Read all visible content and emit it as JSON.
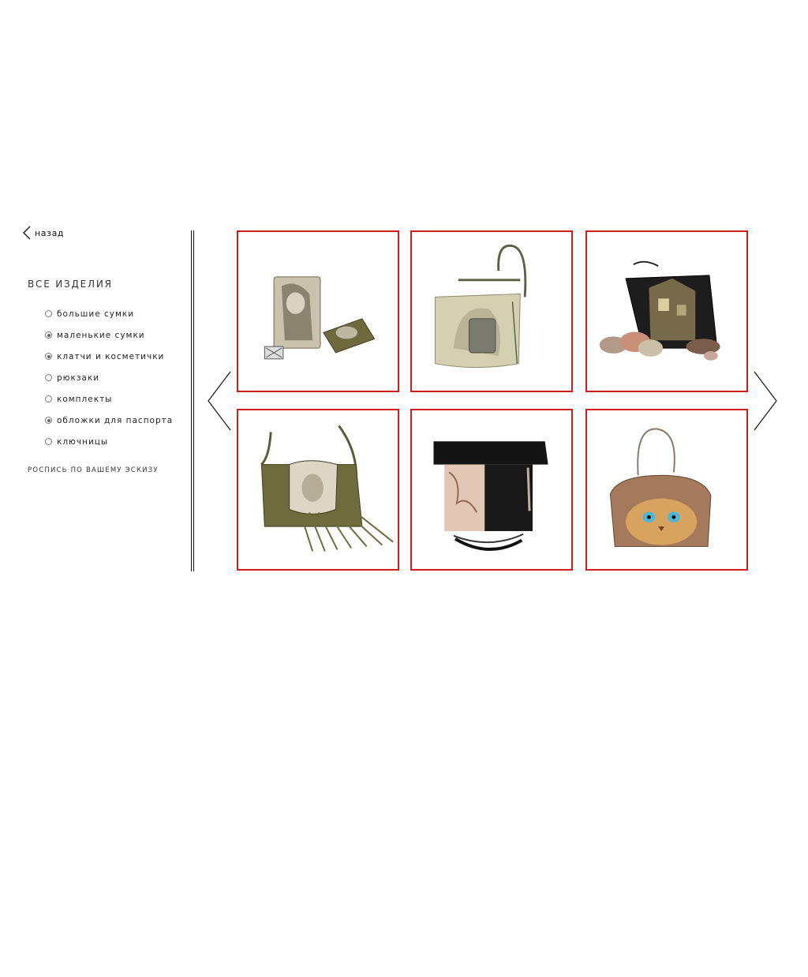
{
  "nav": {
    "back_label": "назад"
  },
  "catalog": {
    "title": "ВСЕ ИЗДЕЛИЯ",
    "categories": [
      {
        "label": "большие сумки",
        "checked": false
      },
      {
        "label": "маленькие сумки",
        "checked": true
      },
      {
        "label": "клатчи и косметички",
        "checked": true
      },
      {
        "label": "рюкзаки",
        "checked": false
      },
      {
        "label": "комплекты",
        "checked": false
      },
      {
        "label": "обложки для паспорта",
        "checked": true
      },
      {
        "label": "ключницы",
        "checked": false
      }
    ],
    "custom_label": "РОСПИСЬ ПО ВАШЕМУ ЭСКИЗУ"
  },
  "gallery": {
    "products": [
      {
        "name": "passport-cover-set-image"
      },
      {
        "name": "beige-crossbody-bag-image"
      },
      {
        "name": "black-clutch-with-stones-image"
      },
      {
        "name": "olive-fringe-bag-image"
      },
      {
        "name": "black-beige-folding-bag-image"
      },
      {
        "name": "cat-painted-bag-image"
      }
    ]
  },
  "colors": {
    "card_border": "#d01c1c",
    "text": "#222222"
  }
}
